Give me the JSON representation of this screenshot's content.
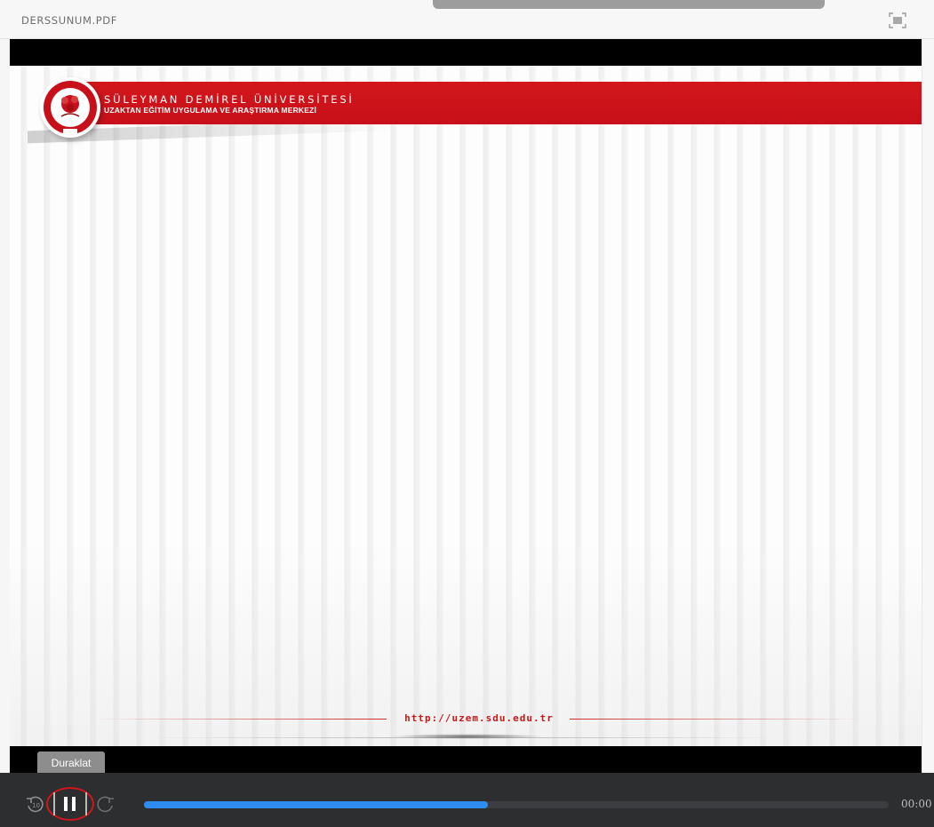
{
  "header": {
    "document_title": "DERSSUNUM.PDF",
    "fullscreen_icon": "fullscreen-icon"
  },
  "slide": {
    "university_name": "SÜLEYMAN DEMİREL ÜNİVERSİTESİ",
    "center_name": "UZAKTAN EĞİTİM UYGULAMA VE ARAŞTIRMA MERKEZİ",
    "url": "http://uzem.sdu.edu.tr",
    "logo_icon": "university-seal-icon",
    "accent_color": "#d2161b"
  },
  "player": {
    "tooltip": "Duraklat",
    "rewind_icon": "rewind-icon",
    "pause_icon": "pause-icon",
    "forward_icon": "forward-icon",
    "progress_fraction": 0.462,
    "time": "00:00",
    "progress_color": "#2f8cf0"
  }
}
